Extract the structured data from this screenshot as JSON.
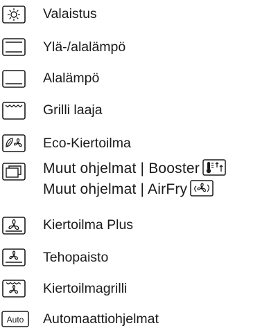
{
  "items": [
    {
      "icon": "light-bulb-icon",
      "label": "Valaistus"
    },
    {
      "icon": "top-bottom-heat-icon",
      "label": "Ylä-/alalämpö"
    },
    {
      "icon": "bottom-heat-icon",
      "label": "Alalämpö"
    },
    {
      "icon": "grill-large-icon",
      "label": "Grilli laaja"
    },
    {
      "icon": "eco-fan-icon",
      "label": "Eco-Kiertoilma"
    },
    {
      "icon": "other-programs-icon",
      "label_line1": "Muut ohjelmat | Booster",
      "label_line1_icon": "booster-thermometer-icon",
      "label_line2": "Muut ohjelmat | AirFry",
      "label_line2_icon": "airfry-icon"
    },
    {
      "icon": "fan-plus-icon",
      "label": "Kiertoilma Plus"
    },
    {
      "icon": "intensive-bake-icon",
      "label": "Tehopaisto"
    },
    {
      "icon": "fan-grill-icon",
      "label": "Kiertoilmagrilli"
    },
    {
      "icon": "auto-programs-icon",
      "icon_text": "Auto",
      "label": "Automaattiohjelmat"
    }
  ]
}
